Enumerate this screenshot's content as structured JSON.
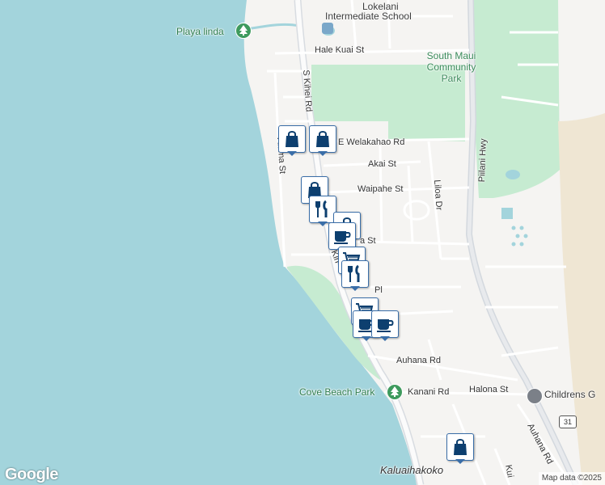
{
  "map": {
    "labels": {
      "school": "Lokelani Intermediate School",
      "school_top": "Lokelani",
      "school_bottom": "Intermediate School",
      "playa": "Playa linda",
      "hale_kuai": "Hale Kuai St",
      "skihei": "S Kihei Rd",
      "community_park_1": "South Maui",
      "community_park_2": "Community",
      "community_park_3": "Park",
      "welakahao": "E Welakahao Rd",
      "kulanihakoi": "Alama St",
      "akai": "Akai St",
      "waipahe": "Waipahe St",
      "liloa": "Liloa Dr",
      "piilani": "Piilani Hwy",
      "ulu": "a St",
      "kihei_mid": "Kih",
      "pl": "Pl",
      "auhana_rd": "Auhana Rd",
      "halona": "Halona St",
      "childrens": "Childrens G",
      "cove_beach": "Cove Beach Park",
      "kanani": "Kanani Rd",
      "auhana_rd_2": "Auhana Rd",
      "kalua": "Kaluaihakoko",
      "kui": "Kui",
      "hwy_num": "31"
    },
    "attribution": "Map data ©2025",
    "logo": "Google",
    "colors": {
      "water": "#a3d4dc",
      "park": "#c6ebd1",
      "road": "#ffffff",
      "highway": "#d6dbe0",
      "pin_border": "#3a6ea8",
      "pin_icon": "#0d3f6f"
    },
    "pins": [
      {
        "icon": "shopping-bag-icon"
      },
      {
        "icon": "shopping-bag-icon"
      },
      {
        "icon": "shopping-bag-icon"
      },
      {
        "icon": "restaurant-icon"
      },
      {
        "icon": "shopping-bag-icon"
      },
      {
        "icon": "coffee-icon"
      },
      {
        "icon": "shopping-cart-icon"
      },
      {
        "icon": "restaurant-icon"
      },
      {
        "icon": "shopping-cart-icon"
      },
      {
        "icon": "coffee-icon"
      },
      {
        "icon": "coffee-icon"
      },
      {
        "icon": "shopping-bag-icon"
      }
    ]
  }
}
